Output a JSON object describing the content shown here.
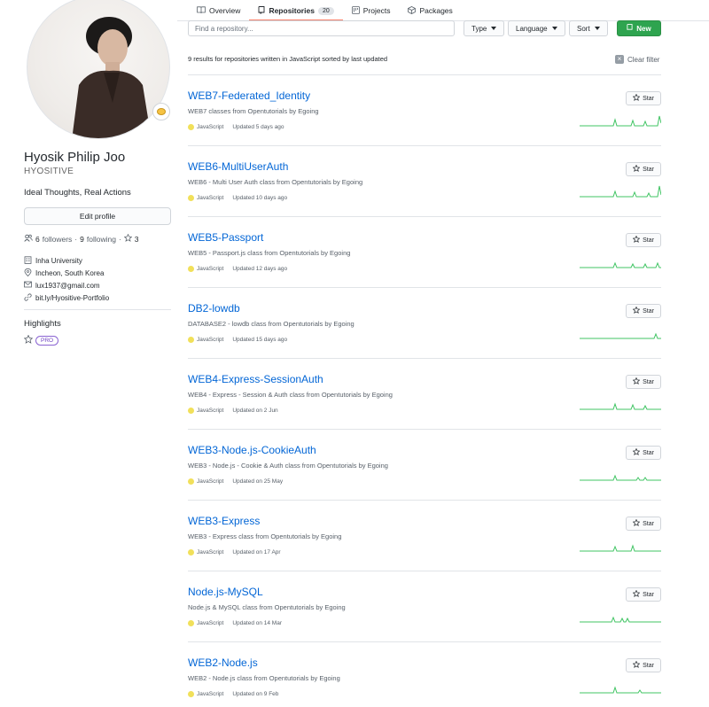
{
  "profile": {
    "full_name": "Hyosik Philip Joo",
    "handle": "HYOSITIVE",
    "bio": "Ideal Thoughts, Real Actions",
    "edit_label": "Edit profile",
    "followers_count": "6",
    "followers_label": "followers",
    "following_count": "9",
    "following_label": "following",
    "stars_count": "3",
    "organization": "Inha University",
    "location": "Incheon, South Korea",
    "email": "lux1937@gmail.com",
    "website": "bit.ly/Hyositive-Portfolio",
    "highlights_title": "Highlights",
    "pro_label": "PRO"
  },
  "tabs": [
    {
      "label": "Overview",
      "icon": "book-icon"
    },
    {
      "label": "Repositories",
      "icon": "repo-icon",
      "count": "20",
      "active": true
    },
    {
      "label": "Projects",
      "icon": "project-icon"
    },
    {
      "label": "Packages",
      "icon": "package-icon"
    }
  ],
  "filters": {
    "search_placeholder": "Find a repository...",
    "type_label": "Type",
    "language_label": "Language",
    "sort_label": "Sort",
    "new_label": "New"
  },
  "results_text": "9 results for repositories written in JavaScript sorted by last updated",
  "clear_filter_label": "Clear filter",
  "star_label": "Star",
  "colors": {
    "link": "#0366d6",
    "javascript": "#f1e05a",
    "new_button": "#2ea44f",
    "active_tab": "#f9826c",
    "sparkline": "#40c463"
  },
  "repos": [
    {
      "name": "WEB7-Federated_Identity",
      "description": "WEB7 classes from Opentutorials by Egoing",
      "language": "JavaScript",
      "updated": "Updated 5 days ago"
    },
    {
      "name": "WEB6-MultiUserAuth",
      "description": "WEB6 - Multi User Auth class from Opentutorials by Egoing",
      "language": "JavaScript",
      "updated": "Updated 10 days ago"
    },
    {
      "name": "WEB5-Passport",
      "description": "WEB5 - Passport.js class from Opentutorials by Egoing",
      "language": "JavaScript",
      "updated": "Updated 12 days ago"
    },
    {
      "name": "DB2-lowdb",
      "description": "DATABASE2 - lowdb class from Opentutorials by Egoing",
      "language": "JavaScript",
      "updated": "Updated 15 days ago"
    },
    {
      "name": "WEB4-Express-SessionAuth",
      "description": "WEB4 - Express - Session & Auth class from Opentutorials by Egoing",
      "language": "JavaScript",
      "updated": "Updated on 2 Jun"
    },
    {
      "name": "WEB3-Node.js-CookieAuth",
      "description": "WEB3 - Node.js - Cookie & Auth class from Opentutorials by Egoing",
      "language": "JavaScript",
      "updated": "Updated on 25 May"
    },
    {
      "name": "WEB3-Express",
      "description": "WEB3 - Express class from Opentutorials by Egoing",
      "language": "JavaScript",
      "updated": "Updated on 17 Apr"
    },
    {
      "name": "Node.js-MySQL",
      "description": "Node.js & MySQL class from Opentutorials by Egoing",
      "language": "JavaScript",
      "updated": "Updated on 14 Mar"
    },
    {
      "name": "WEB2-Node.js",
      "description": "WEB2 - Node.js class from Opentutorials by Egoing",
      "language": "JavaScript",
      "updated": "Updated on 9 Feb"
    }
  ]
}
